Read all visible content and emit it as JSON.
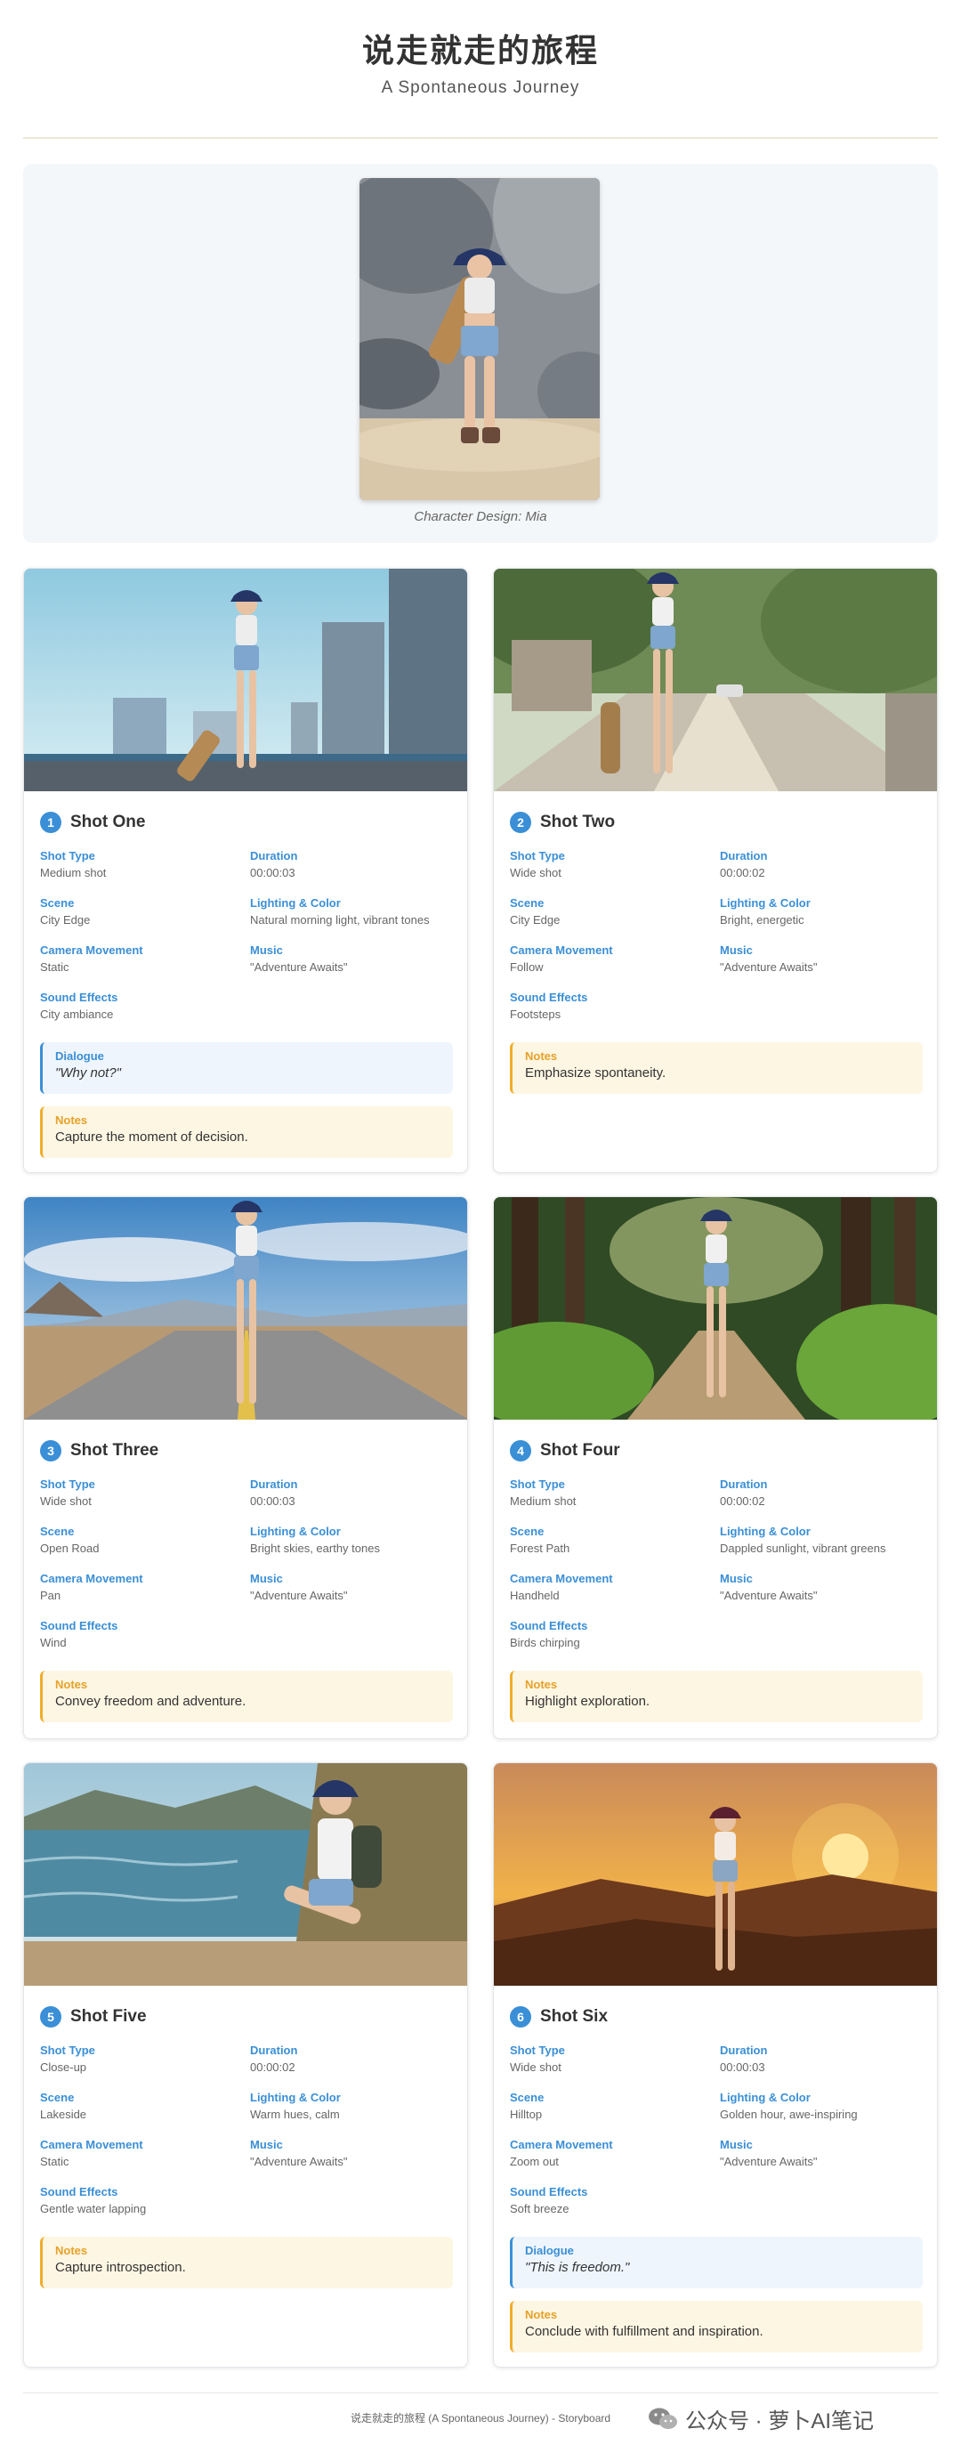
{
  "header": {
    "title": "说走就走的旅程",
    "subtitle": "A Spontaneous Journey"
  },
  "character": {
    "caption": "Character Design: Mia"
  },
  "field_labels": {
    "shot_type": "Shot Type",
    "duration": "Duration",
    "scene": "Scene",
    "lighting": "Lighting & Color",
    "camera": "Camera Movement",
    "music": "Music",
    "sound": "Sound Effects",
    "dialogue": "Dialogue",
    "notes": "Notes"
  },
  "shots": [
    {
      "num": "1",
      "title": "Shot One",
      "shot_type": "Medium shot",
      "duration": "00:00:03",
      "scene": "City Edge",
      "lighting": "Natural morning light, vibrant tones",
      "camera": "Static",
      "music": "\"Adventure Awaits\"",
      "sound": "City ambiance",
      "dialogue": "\"Why not?\"",
      "notes": "Capture the moment of decision."
    },
    {
      "num": "2",
      "title": "Shot Two",
      "shot_type": "Wide shot",
      "duration": "00:00:02",
      "scene": "City Edge",
      "lighting": "Bright, energetic",
      "camera": "Follow",
      "music": "\"Adventure Awaits\"",
      "sound": "Footsteps",
      "notes": "Emphasize spontaneity."
    },
    {
      "num": "3",
      "title": "Shot Three",
      "shot_type": "Wide shot",
      "duration": "00:00:03",
      "scene": "Open Road",
      "lighting": "Bright skies, earthy tones",
      "camera": "Pan",
      "music": "\"Adventure Awaits\"",
      "sound": "Wind",
      "notes": "Convey freedom and adventure."
    },
    {
      "num": "4",
      "title": "Shot Four",
      "shot_type": "Medium shot",
      "duration": "00:00:02",
      "scene": "Forest Path",
      "lighting": "Dappled sunlight, vibrant greens",
      "camera": "Handheld",
      "music": "\"Adventure Awaits\"",
      "sound": "Birds chirping",
      "notes": "Highlight exploration."
    },
    {
      "num": "5",
      "title": "Shot Five",
      "shot_type": "Close-up",
      "duration": "00:00:02",
      "scene": "Lakeside",
      "lighting": "Warm hues, calm",
      "camera": "Static",
      "music": "\"Adventure Awaits\"",
      "sound": "Gentle water lapping",
      "notes": "Capture introspection."
    },
    {
      "num": "6",
      "title": "Shot Six",
      "shot_type": "Wide shot",
      "duration": "00:00:03",
      "scene": "Hilltop",
      "lighting": "Golden hour, awe-inspiring",
      "camera": "Zoom out",
      "music": "\"Adventure Awaits\"",
      "sound": "Soft breeze",
      "dialogue": "\"This is freedom.\"",
      "notes": "Conclude with fulfillment and inspiration."
    }
  ],
  "footer": {
    "text": "说走就走的旅程 (A Spontaneous Journey) - Storyboard"
  },
  "watermark": {
    "text": "公众号 · 萝卜AI笔记"
  },
  "colors": {
    "accent": "#3a8fd6",
    "notes_accent": "#f0ad2a",
    "panel_bg": "#f4f7f9"
  }
}
